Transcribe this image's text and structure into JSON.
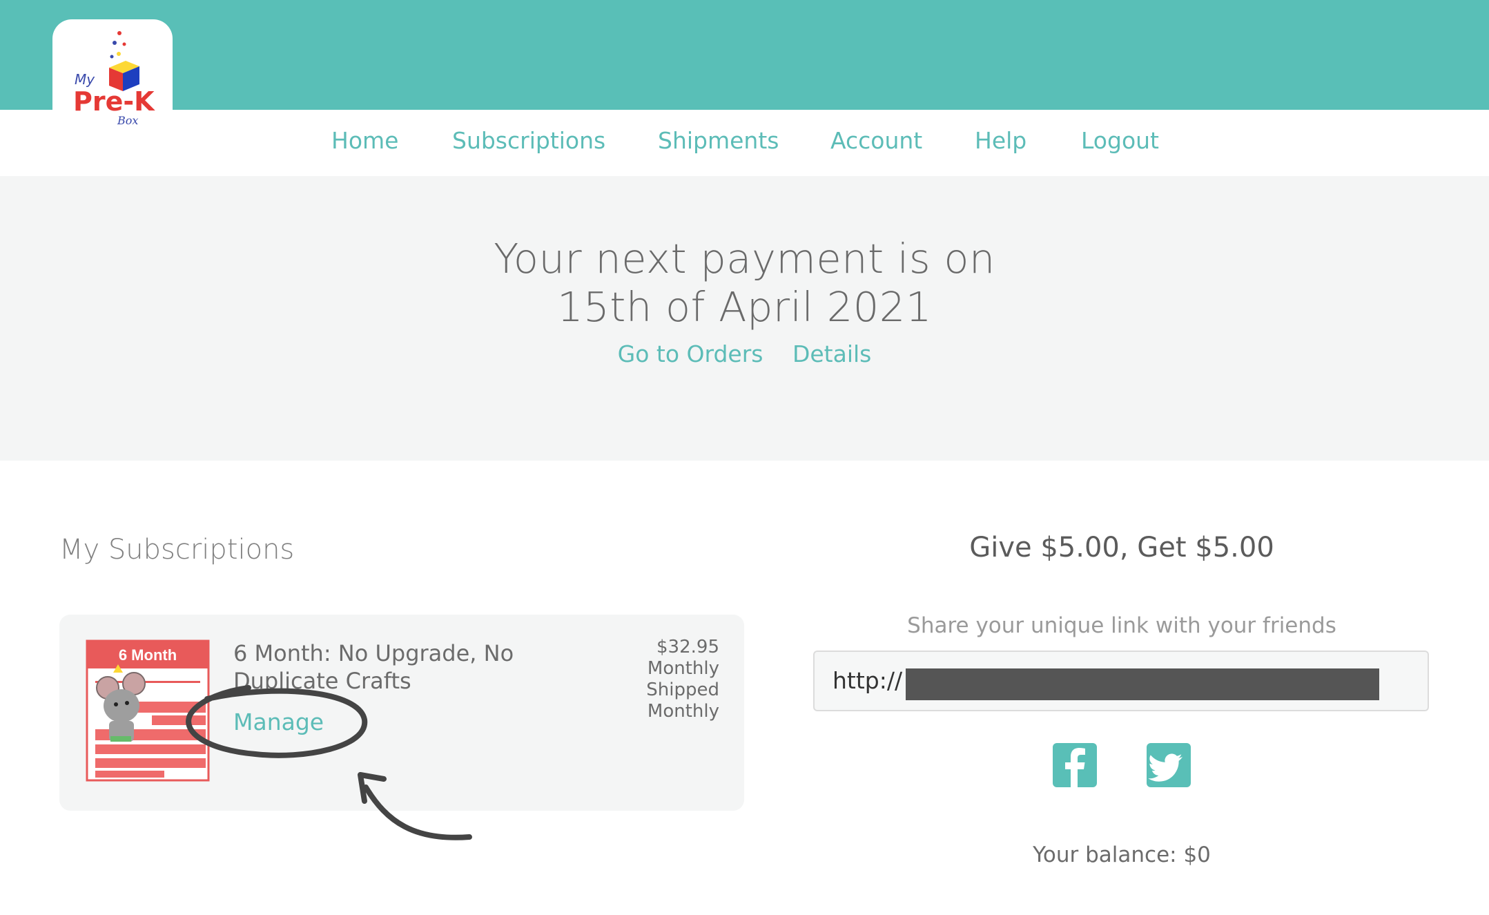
{
  "logo": {
    "line1": "My",
    "line2": "Pre-K",
    "line3": "Box"
  },
  "nav": {
    "home": "Home",
    "subscriptions": "Subscriptions",
    "shipments": "Shipments",
    "account": "Account",
    "help": "Help",
    "logout": "Logout"
  },
  "hero": {
    "line1": "Your next payment is on",
    "line2": "15th of April 2021",
    "go_to_orders": "Go to Orders",
    "details": "Details"
  },
  "subscriptions": {
    "title": "My Subscriptions",
    "items": [
      {
        "thumb_label": "6 Month",
        "name": "6 Month: No Upgrade, No Duplicate Crafts",
        "manage": "Manage",
        "price": "$32.95",
        "billing": "Monthly",
        "shipped_label": "Shipped",
        "shipping": "Monthly"
      }
    ]
  },
  "referral": {
    "title": "Give $5.00, Get $5.00",
    "subtitle": "Share your unique link with your friends",
    "link_prefix": "http://",
    "balance": "Your balance: $0"
  },
  "icons": {
    "facebook": "facebook-icon",
    "twitter": "twitter-icon"
  },
  "colors": {
    "brand_teal": "#59bfb7",
    "link_teal": "#5cbcb7",
    "hero_bg": "#f4f5f5"
  }
}
